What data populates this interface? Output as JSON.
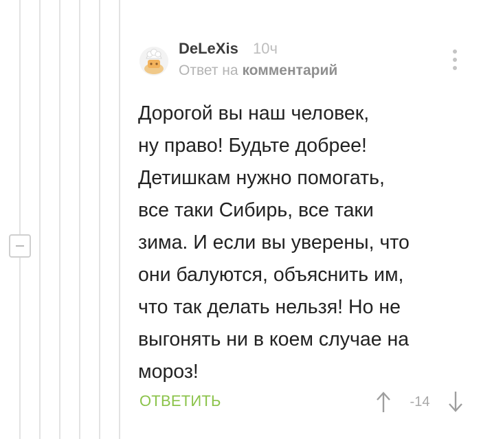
{
  "comment": {
    "author": "DeLeXis",
    "time": "10ч",
    "reply_prefix": "Ответ на",
    "reply_link": "комментарий",
    "text": "Дорогой вы наш человек,\nну право! Будьте добрее!\nДетишкам нужно помогать,\nвсе таки Сибирь, все таки\nзима. И если вы уверены, что\nони балуются, объяснить им,\nчто так делать нельзя! Но не\nвыгонять ни в коем случае на\nмороз!",
    "reply_button": "ОТВЕТИТЬ",
    "rating": "-14"
  },
  "icons": {
    "avatar": "cook-avatar-icon",
    "more": "more-vertical-icon",
    "vote_up": "arrow-up-icon",
    "vote_down": "arrow-down-icon",
    "collapse": "minus-icon"
  },
  "colors": {
    "accent": "#8bc34a",
    "thread_line": "#e3e3e3",
    "text": "#222222",
    "muted": "#b3b3b3"
  }
}
